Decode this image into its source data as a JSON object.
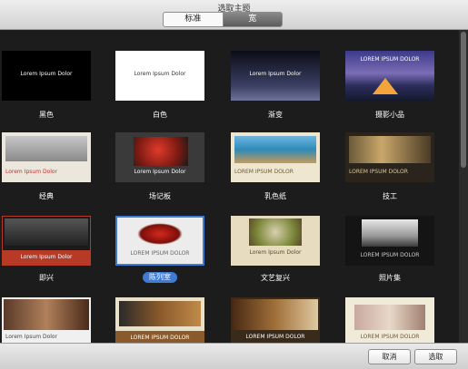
{
  "window": {
    "title": "选取主题"
  },
  "segments": [
    {
      "label": "标准"
    },
    {
      "label": "宽"
    }
  ],
  "themes": [
    {
      "label": "黑色",
      "thumb_title": "Lorem Ipsum Dolor"
    },
    {
      "label": "白色",
      "thumb_title": "Lorem Ipsum Dolor"
    },
    {
      "label": "渐变",
      "thumb_title": "Lorem Ipsum Dolor"
    },
    {
      "label": "摄影小品",
      "thumb_title": "LOREM IPSUM DOLOR"
    },
    {
      "label": "经典",
      "thumb_title": "Lorem Ipsum Dolor"
    },
    {
      "label": "场记板",
      "thumb_title": "Lorem Ipsum Dolor"
    },
    {
      "label": "乳色纸",
      "thumb_title": "LOREM IPSUM DOLOR"
    },
    {
      "label": "技工",
      "thumb_title": "LOREM IPSUM DOLOR"
    },
    {
      "label": "即兴",
      "thumb_title": "Lorem Ipsum Dolor"
    },
    {
      "label": "陈列室",
      "thumb_title": "LOREM IPSUM DOLOR"
    },
    {
      "label": "文艺复兴",
      "thumb_title": "Lorem Ipsum Dolor"
    },
    {
      "label": "照片集",
      "thumb_title": "LOREM IPSUM DOLOR"
    },
    {
      "label": "",
      "thumb_title": "Lorem Ipsum Dolor"
    },
    {
      "label": "",
      "thumb_title": "LOREM IPSUM DOLOR"
    },
    {
      "label": "",
      "thumb_title": "LOREM IPSUM DOLOR"
    },
    {
      "label": "",
      "thumb_title": "LOREM IPSUM DOLOR"
    }
  ],
  "buttons": {
    "cancel": "取消",
    "choose": "选取"
  }
}
